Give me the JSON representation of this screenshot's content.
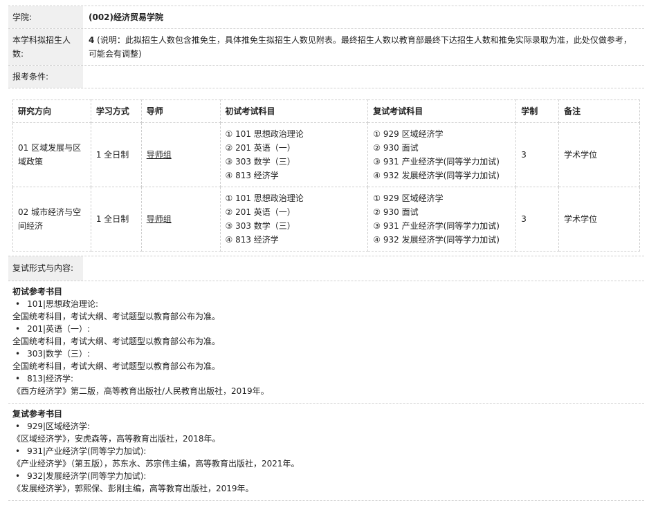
{
  "school": {
    "label": "学院:",
    "value": "(002)经济贸易学院"
  },
  "quota": {
    "label": "本学科拟招生人数:",
    "number": "4",
    "note": " (说明：此拟招生人数包含推免生，具体推免生拟招生人数见附表。最终招生人数以教育部最终下达招生人数和推免实际录取为准，此处仅做参考，可能会有调整)"
  },
  "conditions": {
    "label": "报考条件:",
    "value": ""
  },
  "table": {
    "headers": [
      "研究方向",
      "学习方式",
      "导师",
      "初试考试科目",
      "复试考试科目",
      "学制",
      "备注"
    ],
    "rows": [
      {
        "direction": "01 区域发展与区域政策",
        "mode": "1 全日制",
        "advisor": "导师组",
        "initial": [
          "①  101  思想政治理论",
          "②  201  英语（一）",
          "③  303  数学（三）",
          "④  813  经济学"
        ],
        "retest": [
          "①  929  区域经济学",
          "②  930  面试",
          "③  931  产业经济学(同等学力加试)",
          "④  932  发展经济学(同等学力加试)"
        ],
        "years": "3",
        "remark": "学术学位"
      },
      {
        "direction": "02 城市经济与空间经济",
        "mode": "1 全日制",
        "advisor": "导师组",
        "initial": [
          "①  101  思想政治理论",
          "②  201  英语（一）",
          "③  303  数学（三）",
          "④  813  经济学"
        ],
        "retest": [
          "①  929  区域经济学",
          "②  930  面试",
          "③  931  产业经济学(同等学力加试)",
          "④  932  发展经济学(同等学力加试)"
        ],
        "years": "3",
        "remark": "学术学位"
      }
    ]
  },
  "retest_form": {
    "label": "复试形式与内容:",
    "value": ""
  },
  "initial_books": {
    "title": "初试参考书目",
    "items": [
      {
        "code": "101|思想政治理论:",
        "desc": "全国统考科目，考试大纲、考试题型以教育部公布为准。"
      },
      {
        "code": "201|英语（一）:",
        "desc": "全国统考科目，考试大纲、考试题型以教育部公布为准。"
      },
      {
        "code": "303|数学（三）:",
        "desc": "全国统考科目，考试大纲、考试题型以教育部公布为准。"
      },
      {
        "code": "813|经济学:",
        "desc": "《西方经济学》第二版，高等教育出版社/人民教育出版社，2019年。"
      }
    ]
  },
  "retest_books": {
    "title": "复试参考书目",
    "items": [
      {
        "code": "929|区域经济学:",
        "desc": "《区域经济学》，安虎森等，高等教育出版社，2018年。"
      },
      {
        "code": "931|产业经济学(同等学力加试):",
        "desc": "《产业经济学》（第五版），苏东水、苏宗伟主编，高等教育出版社，2021年。"
      },
      {
        "code": "932|发展经济学(同等学力加试):",
        "desc": "《发展经济学》，郭熙保、彭刚主编，高等教育出版社，2019年。"
      }
    ]
  }
}
